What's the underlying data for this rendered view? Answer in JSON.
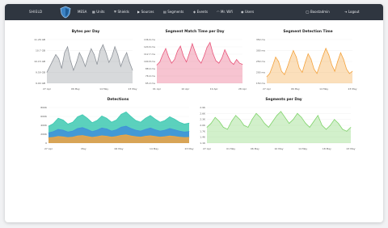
{
  "nav": {
    "brand": "SHIELD",
    "brand2": "MESA",
    "items": [
      {
        "icon": "grid-icon",
        "glyph": "▦",
        "label": "Units"
      },
      {
        "icon": "shield-icon",
        "glyph": "⛨",
        "label": "Shields"
      },
      {
        "icon": "video-icon",
        "glyph": "▶",
        "label": "Sources"
      },
      {
        "icon": "segments-icon",
        "glyph": "▤",
        "label": "Segments"
      },
      {
        "icon": "events-icon",
        "glyph": "◈",
        "label": "Events"
      },
      {
        "icon": "wifi-icon",
        "glyph": "◠",
        "label": "Mr. Wifi"
      },
      {
        "icon": "users-icon",
        "glyph": "◉",
        "label": "Users"
      }
    ],
    "account": {
      "icon": "user-icon",
      "glyph": "◯",
      "label": "Boostadmin"
    },
    "logout": {
      "icon": "logout-icon",
      "glyph": "⇥",
      "label": "Logout"
    }
  },
  "panels": {
    "bytes": {
      "title": "Bytes per Day"
    },
    "match": {
      "title": "Segment Match Time per Day"
    },
    "detection": {
      "title": "Segment Detection Time"
    },
    "detections": {
      "title": "Detections"
    },
    "segments": {
      "title": "Segments per Day"
    }
  },
  "colors": {
    "nav_bg": "#2f3640",
    "bytes": "#8d9299",
    "match": "#e8557a",
    "detection": "#f4a23c",
    "segments": "#7fd36a",
    "det_teal": "#3ec9b1",
    "det_blue": "#3f8fd9",
    "det_orange": "#f2a640"
  },
  "chart_data": [
    {
      "type": "area",
      "id": "bytes",
      "title": "Bytes per Day",
      "ylabels": [
        "11.26 GB",
        "10.7 GB",
        "10.15 GB",
        "9.59 GB",
        "9.04 GB"
      ],
      "x": [
        "27 Apr",
        "06 May",
        "14 May",
        "23 May"
      ],
      "values": [
        9.6,
        9.9,
        10.2,
        10.5,
        10.3,
        9.8,
        10.6,
        10.9,
        10.2,
        9.7,
        10.1,
        10.6,
        10.3,
        9.9,
        10.4,
        10.8,
        10.5,
        10.0,
        10.7,
        11.0,
        10.6,
        10.1,
        10.4,
        10.9,
        10.5,
        9.9,
        10.3,
        10.6,
        10.1,
        9.7
      ],
      "ylim": [
        9.04,
        11.26
      ]
    },
    {
      "type": "area",
      "id": "match",
      "title": "Segment Match Time per Day",
      "ylabels": [
        "136.6 ms",
        "124.6 ms",
        "112.7 ms",
        "100.8 ms",
        "88.9 ms",
        "76.9 ms",
        "65.0 ms"
      ],
      "x": [
        "01 Apr",
        "10 Apr",
        "19 Apr",
        "28 Apr"
      ],
      "values": [
        95,
        100,
        112,
        122,
        108,
        98,
        104,
        118,
        126,
        110,
        100,
        114,
        130,
        116,
        104,
        98,
        110,
        124,
        132,
        114,
        102,
        98,
        106,
        120,
        110,
        100,
        96,
        104,
        98,
        96
      ],
      "ylim": [
        65,
        136.6
      ]
    },
    {
      "type": "area",
      "id": "detection",
      "title": "Segment Detection Time",
      "ylabels": [
        "350 ms",
        "300 ms",
        "250 ms",
        "200 ms",
        "150 ms"
      ],
      "x": [
        "27 Apr",
        "06 May",
        "14 May",
        "23 May"
      ],
      "values": [
        180,
        195,
        230,
        270,
        250,
        205,
        190,
        225,
        265,
        300,
        270,
        220,
        200,
        245,
        285,
        260,
        215,
        195,
        235,
        275,
        310,
        280,
        235,
        205,
        250,
        290,
        260,
        215,
        195,
        205
      ],
      "ylim": [
        150,
        350
      ]
    },
    {
      "type": "area",
      "id": "detections",
      "title": "Detections",
      "ylabels": [
        "800K",
        "600K",
        "400K",
        "200K",
        "0"
      ],
      "x": [
        "27 Apr",
        "May",
        "06 May",
        "14 May",
        "23 May"
      ],
      "series": [
        {
          "name": "",
          "color": "#3ec9b1",
          "values": [
            380,
            440,
            560,
            520,
            430,
            470,
            590,
            640,
            560,
            460,
            510,
            610,
            560,
            470,
            520,
            650,
            700,
            600,
            510,
            470,
            560,
            620,
            540,
            470,
            510,
            590,
            540,
            470,
            430,
            450
          ]
        },
        {
          "name": "",
          "color": "#3f8fd9",
          "values": [
            230,
            260,
            310,
            290,
            250,
            270,
            330,
            350,
            310,
            260,
            290,
            340,
            320,
            270,
            300,
            360,
            380,
            330,
            290,
            270,
            310,
            340,
            300,
            270,
            290,
            330,
            300,
            270,
            250,
            260
          ]
        },
        {
          "name": "",
          "color": "#f2a640",
          "values": [
            120,
            130,
            150,
            140,
            125,
            135,
            160,
            170,
            150,
            130,
            145,
            165,
            155,
            135,
            150,
            175,
            185,
            160,
            145,
            135,
            155,
            165,
            150,
            135,
            145,
            160,
            150,
            135,
            125,
            130
          ]
        }
      ],
      "ylim": [
        0,
        800
      ]
    },
    {
      "type": "area",
      "id": "segments",
      "title": "Segments per Day",
      "ylabels": [
        "2.9K",
        "2.6K",
        "2.3K",
        "2.0K",
        "1.7K",
        "1.4K",
        "1.1K"
      ],
      "x": [
        "27 Apr",
        "01 May",
        "06 May",
        "10 May",
        "14 May",
        "18 May",
        "23 May"
      ],
      "values": [
        1.9,
        2.1,
        2.4,
        2.2,
        1.9,
        1.8,
        2.2,
        2.5,
        2.3,
        2.0,
        1.9,
        2.3,
        2.6,
        2.4,
        2.1,
        1.9,
        2.2,
        2.5,
        2.7,
        2.4,
        2.1,
        2.3,
        2.6,
        2.4,
        2.1,
        1.9,
        2.2,
        2.5,
        2.0,
        1.8,
        2.0,
        2.3,
        2.1,
        1.8,
        1.7,
        1.9
      ],
      "ylim": [
        1.1,
        2.9
      ]
    }
  ]
}
